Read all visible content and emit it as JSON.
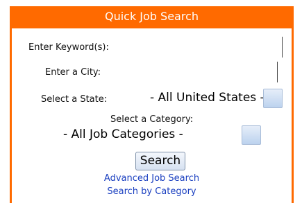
{
  "widget": {
    "title": "Quick Job Search",
    "keyword_label": "Enter Keyword(s):",
    "city_label": "Enter a City:",
    "state_label": "Select a State:",
    "state_value": "- All United States -",
    "category_label": "Select a Category:",
    "category_value": "- All Job Categories -",
    "search_button": "Search",
    "links": {
      "advanced": "Advanced Job Search",
      "by_category": "Search by Category"
    }
  },
  "colors": {
    "header_bg": "#ff6a00",
    "link": "#1a3fc0"
  }
}
